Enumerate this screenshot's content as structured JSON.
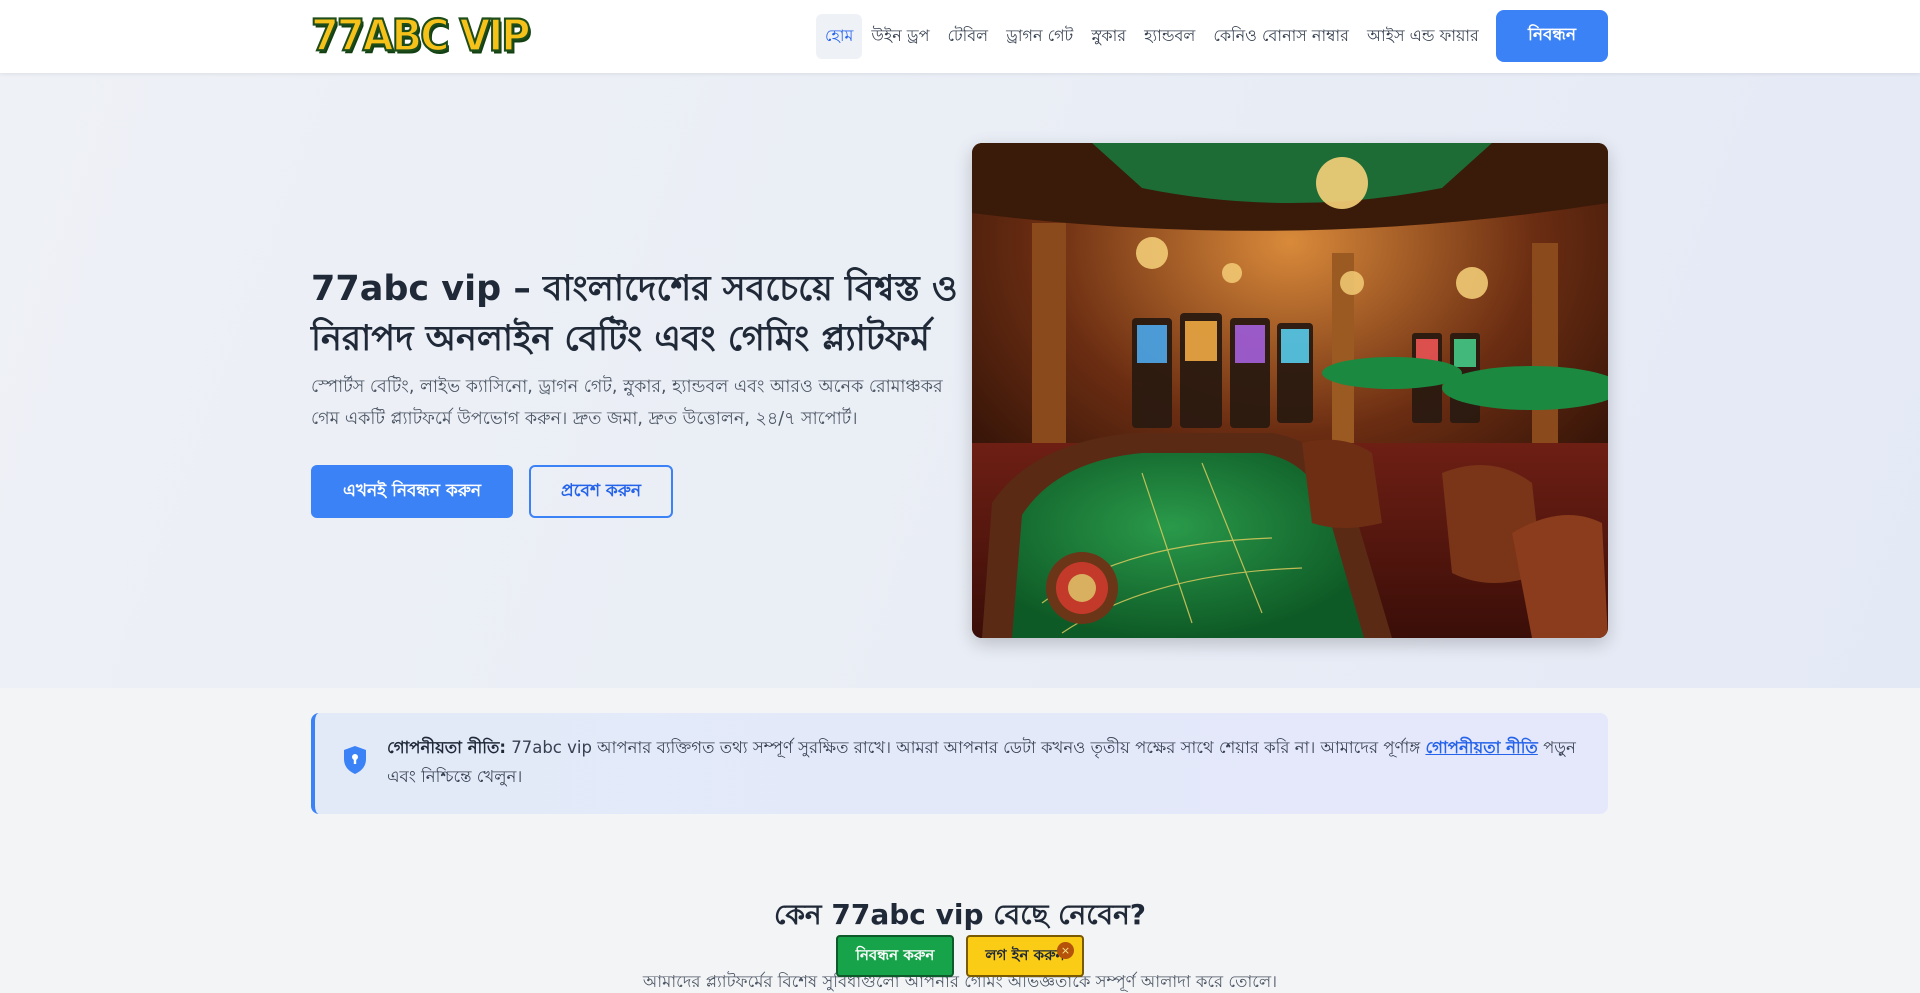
{
  "header": {
    "logo_text": "77ABC VIP",
    "nav": [
      {
        "label": "হোম",
        "active": true
      },
      {
        "label": "উইন ড্রপ"
      },
      {
        "label": "টেবিল"
      },
      {
        "label": "ড্রাগন গেট"
      },
      {
        "label": "স্নুকার"
      },
      {
        "label": "হ্যান্ডবল"
      },
      {
        "label": "কেনিও বোনাস নাম্বার"
      },
      {
        "label": "আইস এন্ড ফায়ার"
      }
    ],
    "register_label": "নিবন্ধন"
  },
  "hero": {
    "title": "77abc vip – বাংলাদেশের সবচেয়ে বিশ্বস্ত ও নিরাপদ অনলাইন বেটিং এবং গেমিং প্ল্যাটফর্ম",
    "description": "স্পোর্টস বেটিং, লাইভ ক্যাসিনো, ড্রাগন গেট, স্নুকার, হ্যান্ডবল এবং আরও অনেক রোমাঞ্চকর গেম একটি প্ল্যাটফর্মে উপভোগ করুন। দ্রুত জমা, দ্রুত উত্তোলন, ২৪/৭ সাপোর্ট।",
    "primary_cta": "এখনই নিবন্ধন করুন",
    "secondary_cta": "প্রবেশ করুন"
  },
  "privacy": {
    "label": "গোপনীয়তা নীতি:",
    "text_before": " 77abc vip আপনার ব্যক্তিগত তথ্য সম্পূর্ণ সুরক্ষিত রাখে। আমরা আপনার ডেটা কখনও তৃতীয় পক্ষের সাথে শেয়ার করি না। আমাদের পূর্ণাঙ্গ ",
    "link": "গোপনীয়তা নীতি",
    "text_after": " পড়ুন এবং নিশ্চিন্তে খেলুন।"
  },
  "why": {
    "title": "কেন 77abc vip বেছে নেবেন?",
    "subtitle": "আমাদের প্ল্যাটফর্মের বিশেষ সুবিধাগুলো আপনার গেমিং অভিজ্ঞতাকে সম্পূর্ণ আলাদা করে তোলে।"
  },
  "floating": {
    "register": "নিবন্ধন করুন",
    "login": "লগ ইন করুন",
    "close": "×"
  },
  "colors": {
    "accent": "#3b82f6",
    "float_register": "#16a34a",
    "float_login": "#facc15"
  }
}
